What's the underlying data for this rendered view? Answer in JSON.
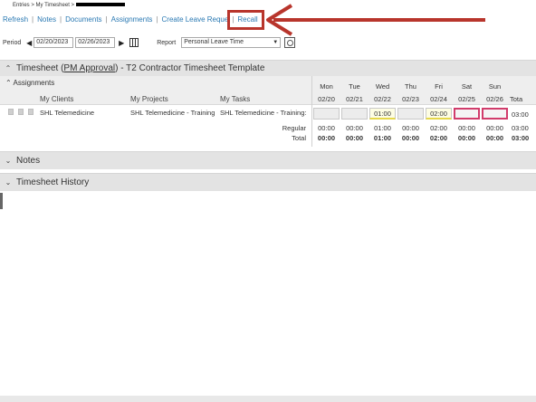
{
  "breadcrumb": {
    "text": "Entries > My Timesheet >"
  },
  "toolbar": {
    "links": [
      "Refresh",
      "Notes",
      "Documents",
      "Assignments",
      "Create Leave Reque",
      "Recall"
    ],
    "separator": "|"
  },
  "period": {
    "label": "Period",
    "start": "02/20/2023",
    "end": "02/26/2023",
    "report_label": "Report",
    "report_value": "Personal Leave Time"
  },
  "timesheet": {
    "prefix": "Timesheet (",
    "approval": "PM Approval",
    "suffix": ") - T2 Contractor Timesheet Template"
  },
  "assignments": {
    "title": "Assignments",
    "col_clients": "My Clients",
    "col_projects": "My Projects",
    "col_tasks": "My Tasks",
    "row": {
      "client": "SHL Telemedicine",
      "project": "SHL Telemedicine - Training",
      "task": "SHL Telemedicine - Training:"
    },
    "regular_label": "Regular",
    "total_label": "Total"
  },
  "days": [
    {
      "name": "Mon",
      "date": "02/20",
      "entry": "",
      "regular": "00:00",
      "total": "00:00"
    },
    {
      "name": "Tue",
      "date": "02/21",
      "entry": "",
      "regular": "00:00",
      "total": "00:00"
    },
    {
      "name": "Wed",
      "date": "02/22",
      "entry": "01:00",
      "regular": "01:00",
      "total": "01:00"
    },
    {
      "name": "Thu",
      "date": "02/23",
      "entry": "",
      "regular": "00:00",
      "total": "00:00"
    },
    {
      "name": "Fri",
      "date": "02/24",
      "entry": "02:00",
      "regular": "02:00",
      "total": "02:00"
    },
    {
      "name": "Sat",
      "date": "02/25",
      "entry": "",
      "regular": "00:00",
      "total": "00:00"
    },
    {
      "name": "Sun",
      "date": "02/26",
      "entry": "",
      "regular": "00:00",
      "total": "00:00"
    }
  ],
  "total_col": {
    "header": "Tota",
    "row": "03:00",
    "regular": "03:00",
    "total": "03:00"
  },
  "sections": {
    "notes": "Notes",
    "history": "Timesheet History"
  },
  "colors": {
    "link": "#2a79b3",
    "callout": "#b8352c",
    "highlight": "#d13c6b"
  }
}
